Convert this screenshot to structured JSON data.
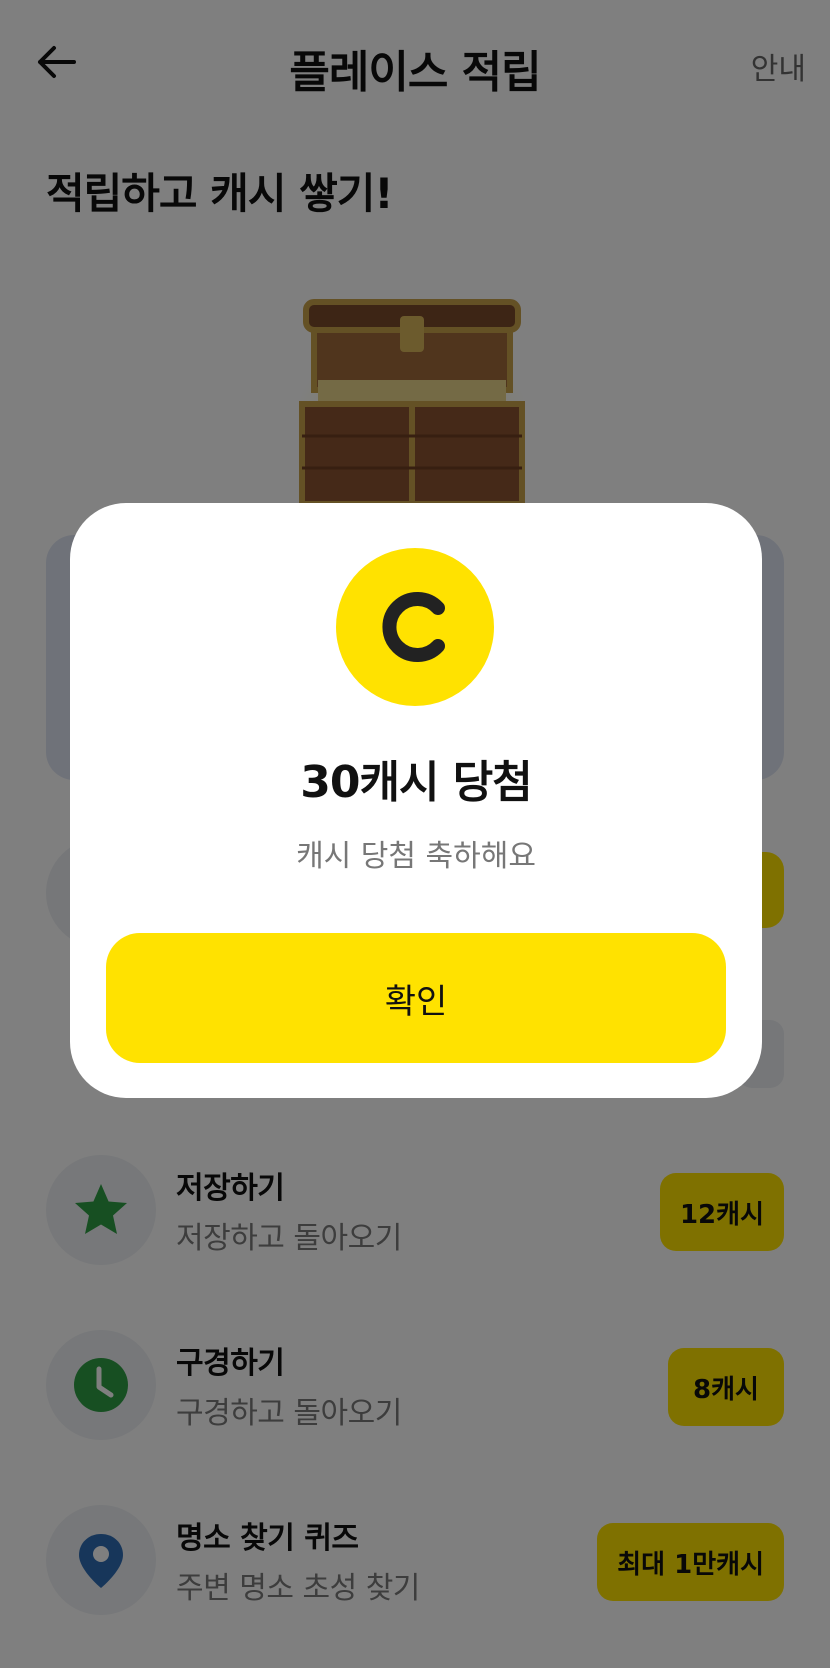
{
  "header": {
    "title": "플레이스 적립",
    "guide_label": "안내"
  },
  "subtitle": "적립하고 캐시 쌓기!",
  "list": [
    {
      "title": "저장하기",
      "subtitle": "저장하고 돌아오기",
      "badge": "12캐시",
      "icon": "star-icon",
      "icon_color": "#2e9e44"
    },
    {
      "title": "구경하기",
      "subtitle": "구경하고 돌아오기",
      "badge": "8캐시",
      "icon": "clock-icon",
      "icon_color": "#2e9e44"
    },
    {
      "title": "명소 찾기 퀴즈",
      "subtitle": "주변 명소 초성 찾기",
      "badge": "최대 1만캐시",
      "icon": "location-pin-icon",
      "icon_color": "#2f6db5"
    }
  ],
  "modal": {
    "title": "30캐시 당첨",
    "message": "캐시 당첨 축하해요",
    "confirm_label": "확인",
    "coin_icon": "cash-coin-icon"
  },
  "colors": {
    "accent": "#ffe200",
    "overlay": "rgba(0,0,0,0.5)"
  }
}
